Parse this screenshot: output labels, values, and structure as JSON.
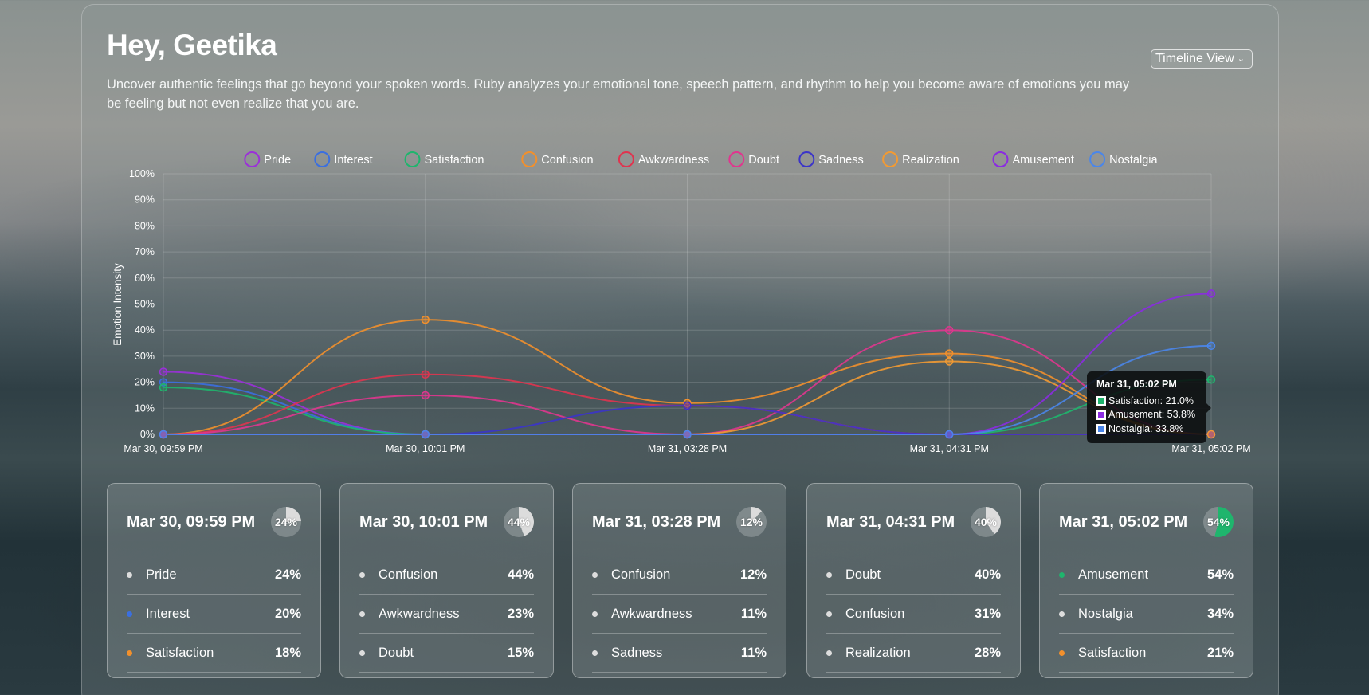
{
  "header": {
    "greeting": "Hey, Geetika",
    "description": "Uncover authentic feelings that go beyond your spoken words. Ruby analyzes your emotional tone, speech pattern, and rhythm to help you become aware of emotions you may be feeling but not even realize that you are.",
    "view_select": "Timeline View"
  },
  "chart_data": {
    "type": "line",
    "ylabel": "Emotion Intensity",
    "xlabel": "",
    "ylim": [
      0,
      100
    ],
    "y_tick_labels": [
      "0%",
      "10%",
      "20%",
      "30%",
      "40%",
      "50%",
      "60%",
      "70%",
      "80%",
      "90%",
      "100%"
    ],
    "categories": [
      "Mar 30, 09:59 PM",
      "Mar 30, 10:01 PM",
      "Mar 31, 03:28 PM",
      "Mar 31, 04:31 PM",
      "Mar 31, 05:02 PM"
    ],
    "grid": true,
    "legend_position": "top",
    "series": [
      {
        "name": "Pride",
        "color": "#9b30d9",
        "values": [
          24,
          0,
          0,
          0,
          0
        ]
      },
      {
        "name": "Interest",
        "color": "#3b6fe0",
        "values": [
          20,
          0,
          0,
          0,
          0
        ]
      },
      {
        "name": "Satisfaction",
        "color": "#1fb56d",
        "values": [
          18,
          0,
          0,
          0,
          21
        ]
      },
      {
        "name": "Confusion",
        "color": "#f2902c",
        "values": [
          0,
          44,
          12,
          31,
          0
        ]
      },
      {
        "name": "Awkwardness",
        "color": "#e0344f",
        "values": [
          0,
          23,
          11,
          0,
          0
        ]
      },
      {
        "name": "Doubt",
        "color": "#e0368e",
        "values": [
          0,
          15,
          0,
          40,
          0
        ]
      },
      {
        "name": "Sadness",
        "color": "#3b34c9",
        "values": [
          0,
          0,
          11,
          0,
          0
        ]
      },
      {
        "name": "Realization",
        "color": "#f29a33",
        "values": [
          0,
          0,
          0,
          28,
          0
        ]
      },
      {
        "name": "Amusement",
        "color": "#8b2be2",
        "values": [
          0,
          0,
          0,
          0,
          54
        ]
      },
      {
        "name": "Nostalgia",
        "color": "#4a86ea",
        "values": [
          0,
          0,
          0,
          0,
          34
        ]
      }
    ]
  },
  "tooltip": {
    "title": "Mar 31, 05:02 PM",
    "rows": [
      {
        "label": "Satisfaction: 21.0%",
        "color": "#1fb56d"
      },
      {
        "label": "Amusement: 53.8%",
        "color": "#8b2be2"
      },
      {
        "label": "Nostalgia: 33.8%",
        "color": "#4a86ea"
      }
    ]
  },
  "cards": [
    {
      "date": "Mar 30, 09:59 PM",
      "top": "24%",
      "top_value": 24,
      "pie_color": "#dcdcdc",
      "items": [
        {
          "name": "Pride",
          "value": "24%",
          "dot": "#dddddd"
        },
        {
          "name": "Interest",
          "value": "20%",
          "dot": "#3b6fe0"
        },
        {
          "name": "Satisfaction",
          "value": "18%",
          "dot": "#f2902c"
        }
      ]
    },
    {
      "date": "Mar 30, 10:01 PM",
      "top": "44%",
      "top_value": 44,
      "pie_color": "#dcdcdc",
      "items": [
        {
          "name": "Confusion",
          "value": "44%",
          "dot": "#dddddd"
        },
        {
          "name": "Awkwardness",
          "value": "23%",
          "dot": "#dddddd"
        },
        {
          "name": "Doubt",
          "value": "15%",
          "dot": "#dddddd"
        }
      ]
    },
    {
      "date": "Mar 31, 03:28 PM",
      "top": "12%",
      "top_value": 12,
      "pie_color": "#dcdcdc",
      "items": [
        {
          "name": "Confusion",
          "value": "12%",
          "dot": "#dddddd"
        },
        {
          "name": "Awkwardness",
          "value": "11%",
          "dot": "#dddddd"
        },
        {
          "name": "Sadness",
          "value": "11%",
          "dot": "#dddddd"
        }
      ]
    },
    {
      "date": "Mar 31, 04:31 PM",
      "top": "40%",
      "top_value": 40,
      "pie_color": "#dcdcdc",
      "items": [
        {
          "name": "Doubt",
          "value": "40%",
          "dot": "#dddddd"
        },
        {
          "name": "Confusion",
          "value": "31%",
          "dot": "#dddddd"
        },
        {
          "name": "Realization",
          "value": "28%",
          "dot": "#dddddd"
        }
      ]
    },
    {
      "date": "Mar 31, 05:02 PM",
      "top": "54%",
      "top_value": 54,
      "pie_color": "#1fb56d",
      "items": [
        {
          "name": "Amusement",
          "value": "54%",
          "dot": "#1fb56d"
        },
        {
          "name": "Nostalgia",
          "value": "34%",
          "dot": "#dddddd"
        },
        {
          "name": "Satisfaction",
          "value": "21%",
          "dot": "#f2902c"
        }
      ]
    }
  ]
}
